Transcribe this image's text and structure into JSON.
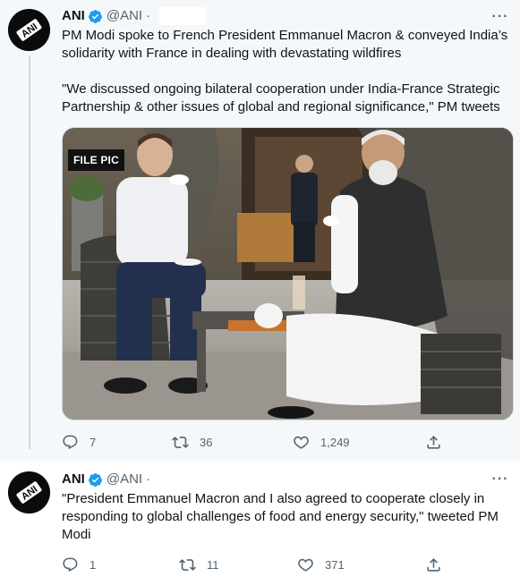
{
  "tweets": [
    {
      "author": {
        "name": "ANI",
        "handle": "@ANI",
        "separator": "·",
        "avatar_text": "ANI"
      },
      "text_lines": [
        "PM Modi spoke to French President Emmanuel Macron & conveyed India’s",
        "solidarity with France in dealing with devastating wildfires"
      ],
      "quote_lines": [
        "\"We discussed ongoing bilateral cooperation under India-France Strategic",
        "Partnership & other issues of global and regional significance,\" PM tweets"
      ],
      "media": {
        "badge": "FILE PIC"
      },
      "stats": {
        "replies": "7",
        "retweets": "36",
        "likes": "1,249"
      }
    },
    {
      "author": {
        "name": "ANI",
        "handle": "@ANI",
        "separator": "·",
        "avatar_text": "ANI"
      },
      "text_lines": [
        "\"President Emmanuel Macron and I also agreed to cooperate closely in",
        "responding to global challenges of food and energy security,\" tweeted PM",
        "Modi"
      ],
      "stats": {
        "replies": "1",
        "retweets": "11",
        "likes": "371"
      }
    }
  ],
  "icons": {
    "verified": "verified-badge-icon",
    "reply": "reply-icon",
    "retweet": "retweet-icon",
    "like": "heart-icon",
    "share": "share-icon",
    "more": "more-icon"
  },
  "colors": {
    "verified": "#1d9bf0",
    "secondary": "#536471",
    "thread_line": "#cfd9de"
  }
}
